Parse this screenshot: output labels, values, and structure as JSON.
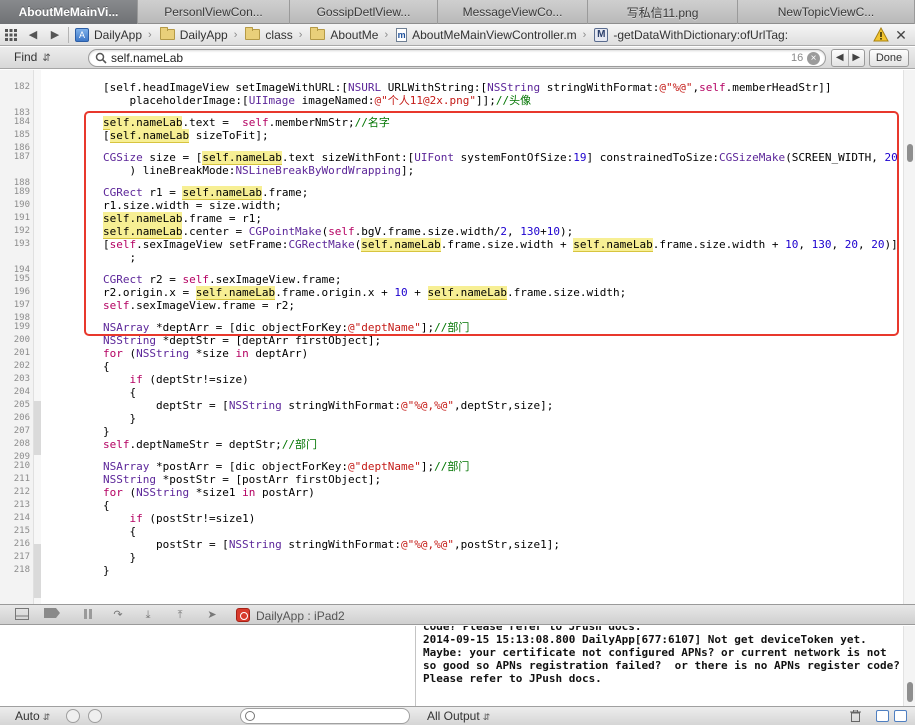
{
  "tabs": [
    {
      "label": "AboutMeMainVi...",
      "active": true
    },
    {
      "label": "PersonlViewCon..."
    },
    {
      "label": "GossipDetlView..."
    },
    {
      "label": "MessageViewCo..."
    },
    {
      "label": "写私信11.png"
    },
    {
      "label": "NewTopicViewC..."
    }
  ],
  "jumpbar": {
    "crumbs": [
      {
        "label": "DailyApp",
        "icon": "project-icon"
      },
      {
        "label": "DailyApp",
        "icon": "folder-icon"
      },
      {
        "label": "class",
        "icon": "folder-icon"
      },
      {
        "label": "AboutMe",
        "icon": "folder-icon"
      },
      {
        "label": "AboutMeMainViewController.m",
        "icon": "m-file-icon"
      },
      {
        "label": "-getDataWithDictionary:ofUrlTag:",
        "icon": "method-icon"
      }
    ],
    "icons": [
      "grid-icon",
      "back-arrow-icon",
      "forward-arrow-icon",
      "warning-icon",
      "close-icon"
    ]
  },
  "findbar": {
    "mode": "Find",
    "query": "self.nameLab",
    "count": "16",
    "done_label": "Done"
  },
  "editor": {
    "lines": [
      {
        "n": "182",
        "parts": [
          [
            "        "
          ],
          [
            "[self.headImageView setImageWithURL:[",
            ""
          ],
          [
            "NSURL",
            "cls"
          ],
          [
            " ",
            ""
          ],
          [
            "URLWithString:[",
            ""
          ],
          [
            "NSString",
            "cls"
          ],
          [
            " stringWithFormat:",
            ""
          ],
          [
            "@\"%@\"",
            "s"
          ],
          [
            ",",
            ""
          ],
          [
            "self",
            "k"
          ],
          [
            ".memberHeadStr]]",
            ""
          ]
        ]
      },
      {
        "n": "",
        "parts": [
          [
            "            placeholderImage:[",
            ""
          ],
          [
            "UIImage",
            "cls"
          ],
          [
            " imageNamed:",
            ""
          ],
          [
            "@\"个人11@2x.png\"",
            "s"
          ],
          [
            "]];",
            ""
          ],
          [
            "//头像",
            "c"
          ]
        ]
      },
      {
        "n": "183",
        "parts": []
      },
      {
        "n": "184",
        "parts": [
          [
            "        "
          ],
          [
            "self.nameLab",
            "hl"
          ],
          [
            ".text =  ",
            ""
          ],
          [
            "self",
            "k"
          ],
          [
            ".memberNmStr;",
            ""
          ],
          [
            "//名字",
            "c"
          ]
        ]
      },
      {
        "n": "185",
        "parts": [
          [
            "        ["
          ],
          [
            "self.nameLab",
            "hl"
          ],
          [
            " sizeToFit];",
            ""
          ]
        ]
      },
      {
        "n": "186",
        "parts": []
      },
      {
        "n": "187",
        "parts": [
          [
            "        "
          ],
          [
            "CGSize",
            "cls"
          ],
          [
            " size = [",
            ""
          ],
          [
            "self.nameLab",
            "hl"
          ],
          [
            ".text sizeWithFont:[",
            ""
          ],
          [
            "UIFont",
            "cls"
          ],
          [
            " systemFontOfSize:",
            ""
          ],
          [
            "19",
            "n"
          ],
          [
            "] constrainedToSize:",
            ""
          ],
          [
            "CGSizeMake",
            "cls"
          ],
          [
            "(SCREEN_WIDTH, ",
            ""
          ],
          [
            "20",
            "n"
          ]
        ]
      },
      {
        "n": "",
        "parts": [
          [
            "            ) lineBreakMode:"
          ],
          [
            "NSLineBreakByWordWrapping",
            "cls"
          ],
          [
            "];",
            ""
          ]
        ]
      },
      {
        "n": "188",
        "parts": []
      },
      {
        "n": "189",
        "parts": [
          [
            "        "
          ],
          [
            "CGRect",
            "cls"
          ],
          [
            " r1 = ",
            ""
          ],
          [
            "self.nameLab",
            "hl"
          ],
          [
            ".frame;",
            ""
          ]
        ]
      },
      {
        "n": "190",
        "parts": [
          [
            "        r1.size.width = size.width;"
          ]
        ]
      },
      {
        "n": "191",
        "parts": [
          [
            "        "
          ],
          [
            "self.nameLab",
            "hl"
          ],
          [
            ".frame = r1;",
            ""
          ]
        ]
      },
      {
        "n": "192",
        "parts": [
          [
            "        "
          ],
          [
            "self.nameLab",
            "hl"
          ],
          [
            ".center = ",
            ""
          ],
          [
            "CGPointMake",
            "cls"
          ],
          [
            "(",
            ""
          ],
          [
            "self",
            "k"
          ],
          [
            ".bgV.frame.size.width/",
            ""
          ],
          [
            "2",
            "n"
          ],
          [
            ", ",
            ""
          ],
          [
            "130",
            "n"
          ],
          [
            "+",
            ""
          ],
          [
            "10",
            "n"
          ],
          [
            ");",
            ""
          ]
        ]
      },
      {
        "n": "193",
        "parts": [
          [
            "        ["
          ],
          [
            "self",
            "k"
          ],
          [
            ".sexImageView setFrame:",
            ""
          ],
          [
            "CGRectMake",
            "cls"
          ],
          [
            "(",
            ""
          ],
          [
            "self.nameLab",
            "hl"
          ],
          [
            ".frame.size.width + ",
            ""
          ],
          [
            "self.nameLab",
            "hl"
          ],
          [
            ".frame.size.width + ",
            ""
          ],
          [
            "10",
            "n"
          ],
          [
            ", ",
            ""
          ],
          [
            "130",
            "n"
          ],
          [
            ", ",
            ""
          ],
          [
            "20",
            "n"
          ],
          [
            ", ",
            ""
          ],
          [
            "20",
            "n"
          ],
          [
            ")]",
            ""
          ]
        ]
      },
      {
        "n": "",
        "parts": [
          [
            "            ;"
          ]
        ]
      },
      {
        "n": "194",
        "parts": []
      },
      {
        "n": "195",
        "parts": [
          [
            "        "
          ],
          [
            "CGRect",
            "cls"
          ],
          [
            " r2 = ",
            ""
          ],
          [
            "self",
            "k"
          ],
          [
            ".sexImageView.frame;",
            ""
          ]
        ]
      },
      {
        "n": "196",
        "parts": [
          [
            "        r2.origin.x = "
          ],
          [
            "self.nameLab",
            "hl"
          ],
          [
            ".frame.origin.x + ",
            ""
          ],
          [
            "10",
            "n"
          ],
          [
            " + ",
            ""
          ],
          [
            "self.nameLab",
            "hl"
          ],
          [
            ".frame.size.width;",
            ""
          ]
        ]
      },
      {
        "n": "197",
        "parts": [
          [
            "        "
          ],
          [
            "self",
            "k"
          ],
          [
            ".sexImageView.frame = r2;",
            ""
          ]
        ]
      },
      {
        "n": "198",
        "parts": []
      },
      {
        "n": "199",
        "parts": [
          [
            "        "
          ],
          [
            "NSArray",
            "cls"
          ],
          [
            " *deptArr = [dic objectForKey:",
            ""
          ],
          [
            "@\"deptName\"",
            "s"
          ],
          [
            "];",
            ""
          ],
          [
            "//部门",
            "c"
          ]
        ]
      },
      {
        "n": "200",
        "parts": [
          [
            "        "
          ],
          [
            "NSString",
            "cls"
          ],
          [
            " *deptStr = [deptArr firstObject];",
            ""
          ]
        ]
      },
      {
        "n": "201",
        "parts": [
          [
            "        "
          ],
          [
            "for",
            "k"
          ],
          [
            " (",
            ""
          ],
          [
            "NSString",
            "cls"
          ],
          [
            " *size ",
            ""
          ],
          [
            "in",
            "k"
          ],
          [
            " deptArr)",
            ""
          ]
        ]
      },
      {
        "n": "202",
        "parts": [
          [
            "        {"
          ]
        ]
      },
      {
        "n": "203",
        "parts": [
          [
            "            "
          ],
          [
            "if",
            "k"
          ],
          [
            " (deptStr!=size)",
            ""
          ]
        ]
      },
      {
        "n": "204",
        "parts": [
          [
            "            {"
          ]
        ]
      },
      {
        "n": "205",
        "parts": [
          [
            "                deptStr = ["
          ],
          [
            "NSString",
            "cls"
          ],
          [
            " stringWithFormat:",
            ""
          ],
          [
            "@\"%@,%@\"",
            "s"
          ],
          [
            ",deptStr,size];",
            ""
          ]
        ]
      },
      {
        "n": "206",
        "parts": [
          [
            "            }"
          ]
        ]
      },
      {
        "n": "207",
        "parts": [
          [
            "        }"
          ]
        ]
      },
      {
        "n": "208",
        "parts": [
          [
            "        "
          ],
          [
            "self",
            "k"
          ],
          [
            ".deptNameStr = deptStr;",
            ""
          ],
          [
            "//部门",
            "c"
          ]
        ]
      },
      {
        "n": "209",
        "parts": []
      },
      {
        "n": "210",
        "parts": [
          [
            "        "
          ],
          [
            "NSArray",
            "cls"
          ],
          [
            " *postArr = [dic objectForKey:",
            ""
          ],
          [
            "@\"deptName\"",
            "s"
          ],
          [
            "];",
            ""
          ],
          [
            "//部门",
            "c"
          ]
        ]
      },
      {
        "n": "211",
        "parts": [
          [
            "        "
          ],
          [
            "NSString",
            "cls"
          ],
          [
            " *postStr = [postArr firstObject];",
            ""
          ]
        ]
      },
      {
        "n": "212",
        "parts": [
          [
            "        "
          ],
          [
            "for",
            "k"
          ],
          [
            " (",
            ""
          ],
          [
            "NSString",
            "cls"
          ],
          [
            " *size1 ",
            ""
          ],
          [
            "in",
            "k"
          ],
          [
            " postArr)",
            ""
          ]
        ]
      },
      {
        "n": "213",
        "parts": [
          [
            "        {"
          ]
        ]
      },
      {
        "n": "214",
        "parts": [
          [
            "            "
          ],
          [
            "if",
            "k"
          ],
          [
            " (postStr!=size1)",
            ""
          ]
        ]
      },
      {
        "n": "215",
        "parts": [
          [
            "            {"
          ]
        ]
      },
      {
        "n": "216",
        "parts": [
          [
            "                postStr = ["
          ],
          [
            "NSString",
            "cls"
          ],
          [
            " stringWithFormat:",
            ""
          ],
          [
            "@\"%@,%@\"",
            "s"
          ],
          [
            ",postStr,size1];",
            ""
          ]
        ]
      },
      {
        "n": "217",
        "parts": [
          [
            "            }"
          ]
        ]
      },
      {
        "n": "218",
        "parts": [
          [
            "        }"
          ]
        ]
      }
    ]
  },
  "debugbar": {
    "scheme": "DailyApp : iPad2"
  },
  "console": {
    "text": "code? Please refer to JPush docs.\n2014-09-15 15:13:08.800 DailyApp[677:6107] Not get deviceToken yet. Maybe: your certificate not configured APNs? or current network is not so good so APNs registration failed?  or there is no APNs register code? Please refer to JPush docs."
  },
  "bottombar": {
    "auto_label": "Auto",
    "output_label": "All Output"
  },
  "colors": {
    "highlight": "#f7ef94",
    "annotation_box": "#e8382c",
    "keyword": "#b40062",
    "string": "#c41a16",
    "comment": "#007400",
    "class": "#5c2699"
  }
}
